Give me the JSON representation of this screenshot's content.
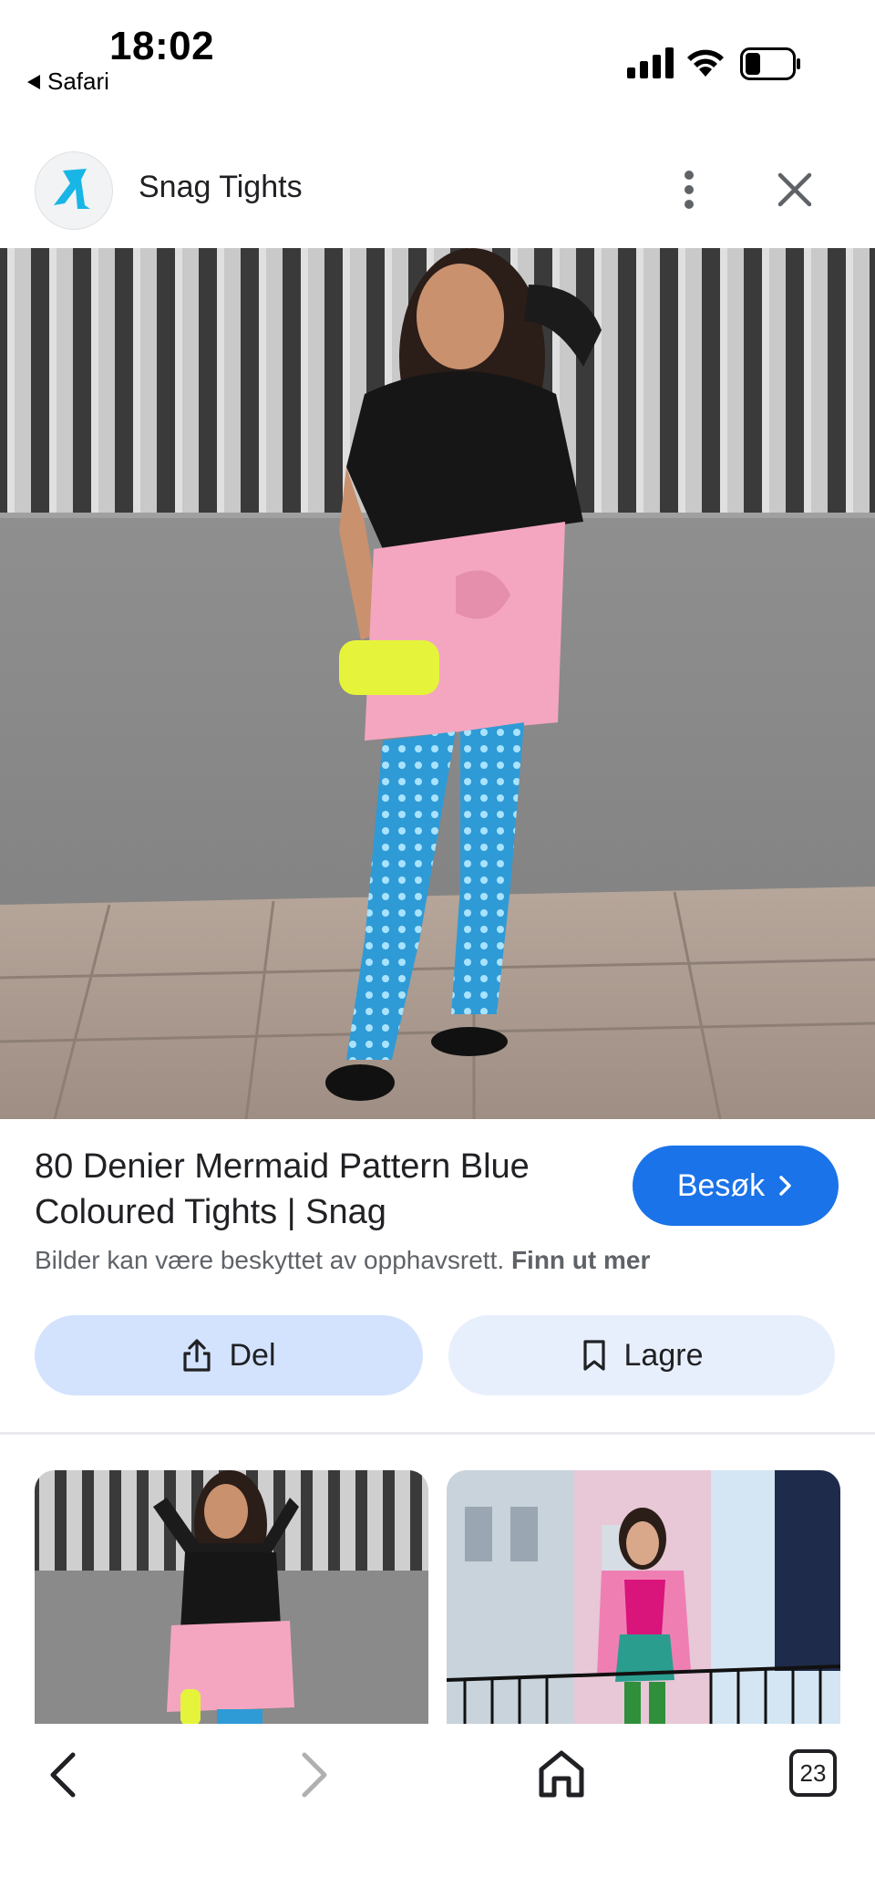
{
  "status_bar": {
    "time": "18:02",
    "back_app": "Safari",
    "icons": [
      "signal-icon",
      "wifi-icon",
      "battery-icon"
    ]
  },
  "header": {
    "site_name": "Snag Tights",
    "logo_icon": "snag-logo-icon",
    "more_icon": "more-vert-icon",
    "close_icon": "close-icon"
  },
  "result": {
    "title": "80 Denier Mermaid Pattern Blue Coloured Tights | Snag",
    "visit_label": "Besøk",
    "copyright_text": "Bilder kan være beskyttet av opphavsrett.",
    "learn_more": "Finn ut mer",
    "share_label": "Del",
    "save_label": "Lagre"
  },
  "bottom_nav": {
    "tabs_count": "23",
    "icons": [
      "back-icon",
      "forward-icon",
      "home-icon",
      "tabs-icon"
    ]
  },
  "colors": {
    "accent": "#1a73e8",
    "tonal_button": "#d3e3fd",
    "tights_blue": "#2e9bd6",
    "skirt_pink": "#f4a6c0"
  }
}
